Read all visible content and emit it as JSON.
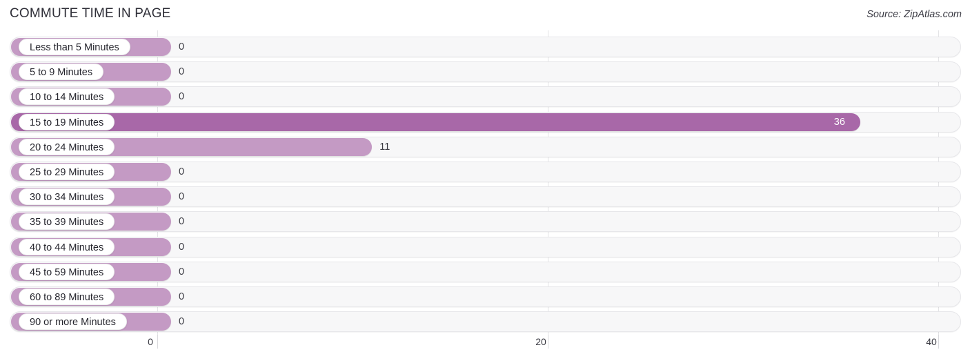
{
  "header": {
    "title": "COMMUTE TIME IN PAGE",
    "source": "Source: ZipAtlas.com"
  },
  "chart_data": {
    "type": "bar",
    "orientation": "horizontal",
    "title": "COMMUTE TIME IN PAGE",
    "xlabel": "",
    "ylabel": "",
    "xlim": [
      0,
      40
    ],
    "ticks": [
      "0",
      "20",
      "40"
    ],
    "tick_values": [
      0,
      20,
      40
    ],
    "grid": true,
    "legend": null,
    "highlight_category": "15 to 19 Minutes",
    "categories": [
      "Less than 5 Minutes",
      "5 to 9 Minutes",
      "10 to 14 Minutes",
      "15 to 19 Minutes",
      "20 to 24 Minutes",
      "25 to 29 Minutes",
      "30 to 34 Minutes",
      "35 to 39 Minutes",
      "40 to 44 Minutes",
      "45 to 59 Minutes",
      "60 to 89 Minutes",
      "90 or more Minutes"
    ],
    "values": [
      0,
      0,
      0,
      36,
      11,
      0,
      0,
      0,
      0,
      0,
      0,
      0
    ],
    "value_labels": [
      "0",
      "0",
      "0",
      "36",
      "11",
      "0",
      "0",
      "0",
      "0",
      "0",
      "0",
      "0"
    ]
  },
  "colors": {
    "bar_light": "#c49ac4",
    "bar_dark": "#a868a8",
    "track": "#f7f7f8",
    "track_border": "#e6e6e9",
    "gridline": "#e3e3e6",
    "text": "#2b2b33",
    "value_inside_text": "#ffffff"
  }
}
